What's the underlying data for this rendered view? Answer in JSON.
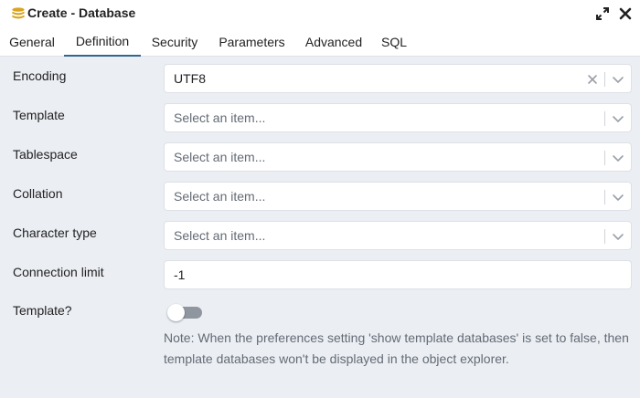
{
  "window": {
    "title": "Create - Database",
    "db_icon": "database-icon",
    "expand_icon": "expand-icon",
    "close_icon": "close-icon"
  },
  "tabs": [
    {
      "label": "General",
      "active": false
    },
    {
      "label": "Definition",
      "active": true
    },
    {
      "label": "Security",
      "active": false
    },
    {
      "label": "Parameters",
      "active": false
    },
    {
      "label": "Advanced",
      "active": false
    },
    {
      "label": "SQL",
      "active": false
    }
  ],
  "form": {
    "encoding": {
      "label": "Encoding",
      "value": "UTF8"
    },
    "template": {
      "label": "Template",
      "placeholder": "Select an item..."
    },
    "tablespace": {
      "label": "Tablespace",
      "placeholder": "Select an item..."
    },
    "collation": {
      "label": "Collation",
      "placeholder": "Select an item..."
    },
    "character_type": {
      "label": "Character type",
      "placeholder": "Select an item..."
    },
    "connection_limit": {
      "label": "Connection limit",
      "value": "-1"
    },
    "is_template": {
      "label": "Template?",
      "checked": false
    },
    "note": "Note: When the preferences setting 'show template databases' is set to false, then template databases won't be displayed in the object explorer."
  },
  "colors": {
    "accent": "#326690",
    "background": "#ebeef3",
    "toggle_off": "#8f969f",
    "muted_text": "#646b75"
  }
}
